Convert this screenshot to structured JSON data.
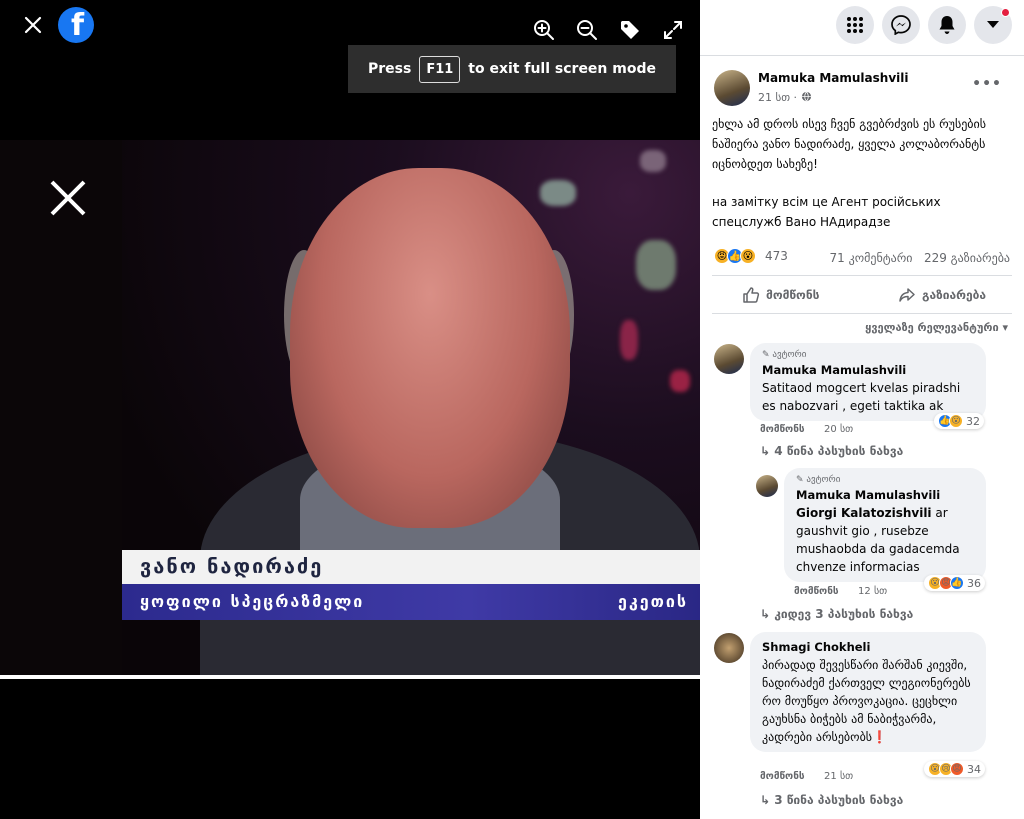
{
  "viewer": {
    "fullscreen_prefix": "Press",
    "fullscreen_key": "F11",
    "fullscreen_suffix": "to exit full screen mode",
    "lower_third_name": "ვანო ნადირაძე",
    "lower_third_role": "ყოფილი სპეცრაზმელი",
    "lower_third_channel": "ეკეთის"
  },
  "post": {
    "author": "Mamuka Mamulashvili",
    "time": "21 სთ",
    "text_ka": "ეხლა ამ დროს ისევ ჩვენ გვებრძვის ეს რუსების ნაშიერა ვანო ნადირაძე, ყველა კოლაბორანტს იცნობდეთ სახეზე!",
    "text_uk": "на замітку всім це Агент російських спецслужб Вано НАдирадзе",
    "reaction_count": "473",
    "comments_count": "71 კომენტარი",
    "shares_count": "229 გაზიარება",
    "like_label": "მომწონს",
    "share_label": "გაზიარება",
    "sort_label": "ყველაზე რელევანტური"
  },
  "comments": [
    {
      "badge": "ავტორი",
      "name": "Mamuka Mamulashvili",
      "text": "Satitaod mogcert kvelas piradshi es nabozvari , egeti taktika ak",
      "like": "მომწონს",
      "time": "20 სთ",
      "reactions": "32",
      "replies": "4 წინა პასუხის ნახვა"
    },
    {
      "badge": "ავტორი",
      "name": "Mamuka Mamulashvili",
      "tag": "Giorgi Kalatozishvili",
      "text": "ar gaushvit gio , rusebze mushaobda da gadacemda chvenze informacias",
      "like": "მომწონს",
      "time": "12 სთ",
      "reactions": "36",
      "replies": "კიდევ 3 პასუხის ნახვა"
    },
    {
      "name": "Shmagi Chokheli",
      "text": "პირადად შევესწარი შარშან კიევში, ნადირაძემ ქართველ ლეგიონერებს რო მოუწყო პროვოკაცია. ცეცხლი გაუხსნა ბიჭებს ამ ნაბიჭვარმა, კადრები არსებობს",
      "like": "მომწონს",
      "time": "21 სთ",
      "reactions": "34",
      "replies": "3 წინა პასუხის ნახვა"
    }
  ],
  "colors": {
    "fb_blue": "#1877f2",
    "panel_bg": "#ffffff",
    "bubble_bg": "#f0f2f5",
    "muted": "#65676b",
    "badge_red": "#e41e3f"
  }
}
